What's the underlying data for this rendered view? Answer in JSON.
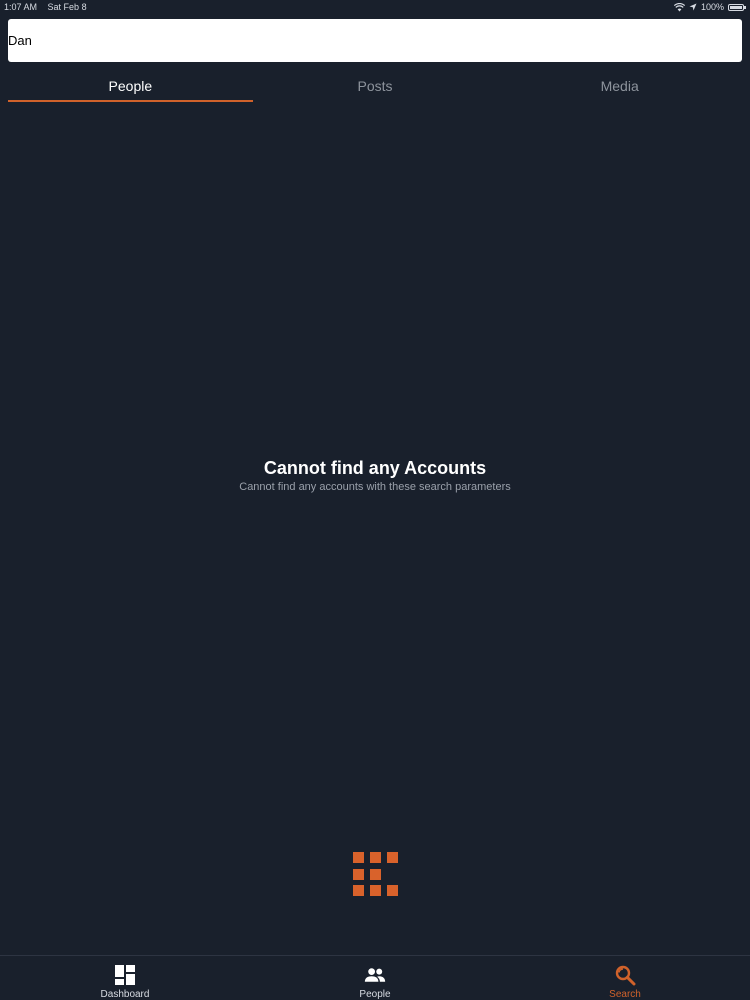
{
  "status_bar": {
    "time": "1:07 AM",
    "date": "Sat Feb 8",
    "battery": "100%"
  },
  "search": {
    "value": "Dan",
    "placeholder": ""
  },
  "tabs": [
    {
      "label": "People",
      "active": true
    },
    {
      "label": "Posts",
      "active": false
    },
    {
      "label": "Media",
      "active": false
    }
  ],
  "empty_state": {
    "title": "Cannot find any Accounts",
    "subtitle": "Cannot find any accounts with these search parameters"
  },
  "colors": {
    "background": "#19202c",
    "accent": "#d0622b",
    "text_muted": "#8d939c"
  },
  "bottom_nav": [
    {
      "label": "Dashboard",
      "icon": "dashboard-icon",
      "active": false
    },
    {
      "label": "People",
      "icon": "people-icon",
      "active": false
    },
    {
      "label": "Search",
      "icon": "search-icon",
      "active": true
    }
  ]
}
